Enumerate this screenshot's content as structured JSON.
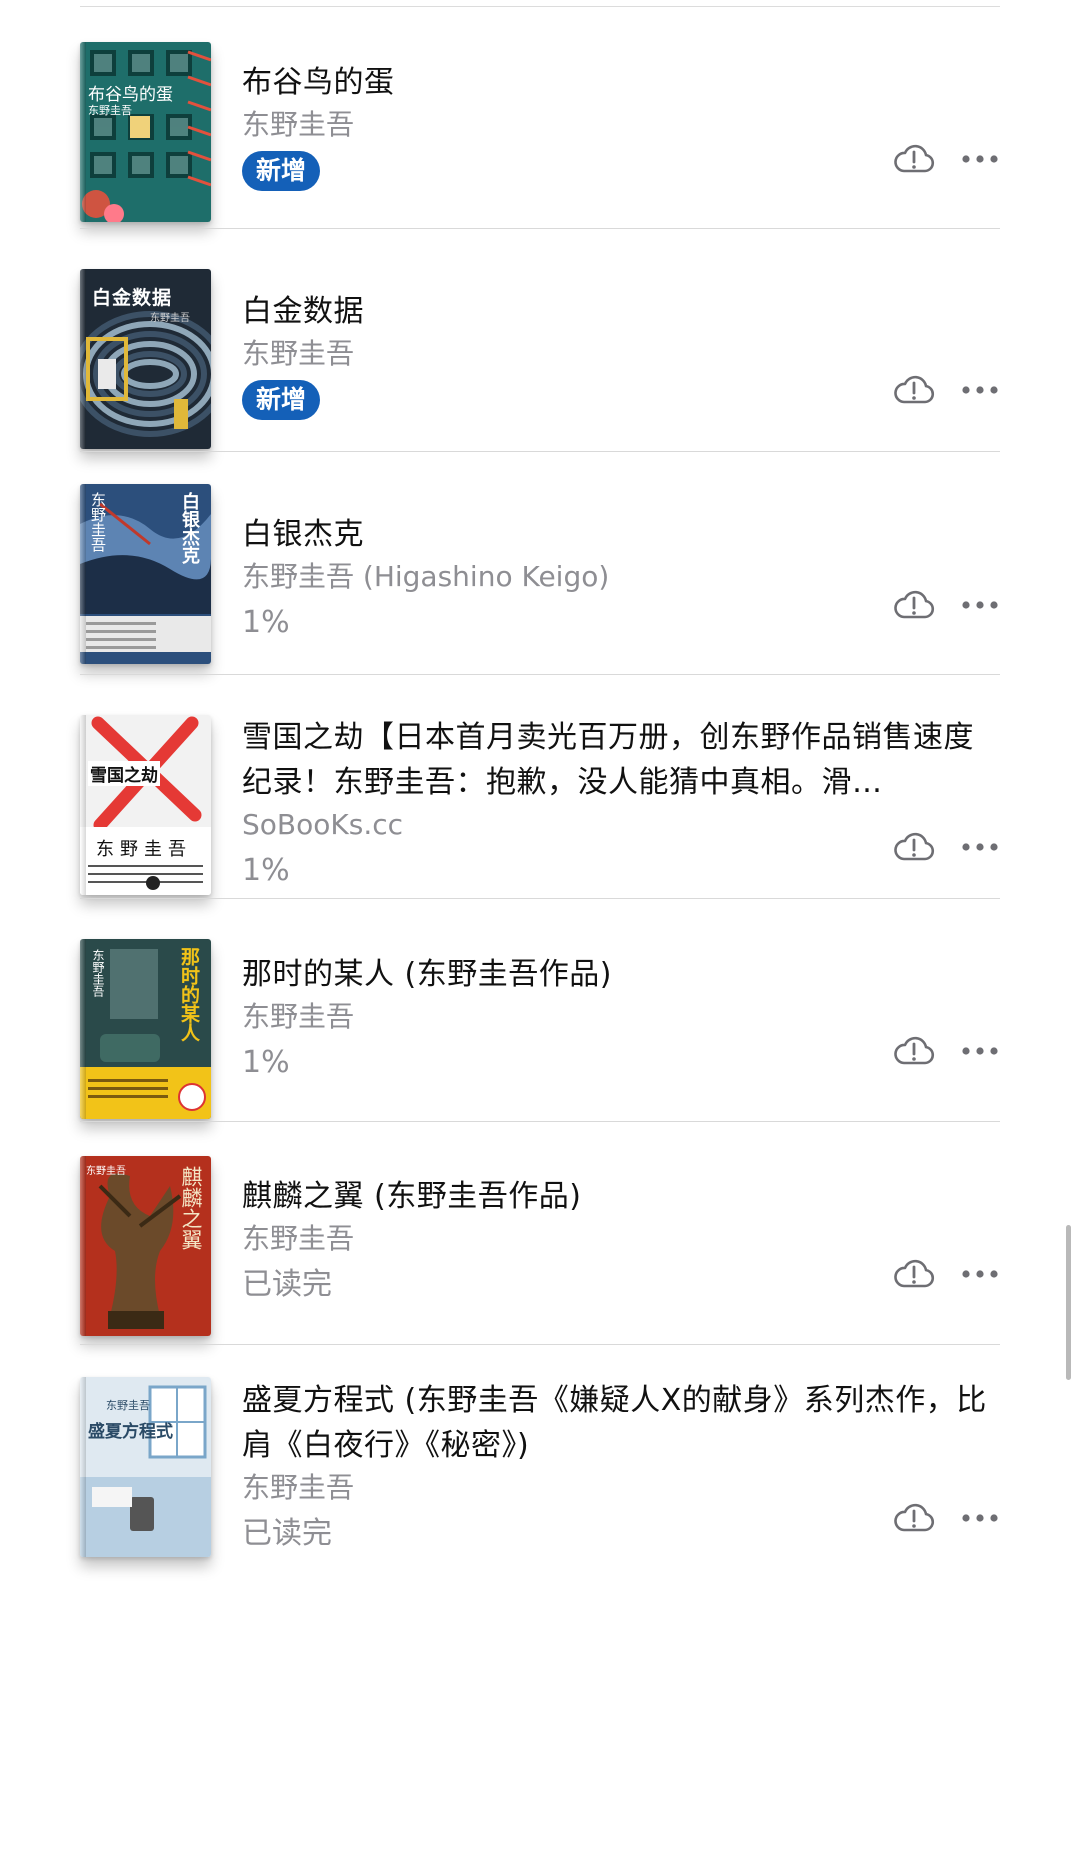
{
  "books": [
    {
      "title": "布谷鸟的蛋",
      "author": "东野圭吾",
      "status_type": "badge",
      "status": "新增",
      "cover": {
        "title": "布谷鸟的蛋",
        "author": "东野圭吾",
        "bg": "#1e6e6a",
        "accent": "#e2513d"
      }
    },
    {
      "title": "白金数据",
      "author": "东野圭吾",
      "status_type": "badge",
      "status": "新增",
      "cover": {
        "title": "白金数据",
        "author": "东野圭吾",
        "bg": "#1f2a36",
        "accent": "#e0b83a"
      }
    },
    {
      "title": "白银杰克",
      "author": "东野圭吾 (Higashino Keigo)",
      "status_type": "text",
      "status": "1%",
      "cover": {
        "title": "白银杰克",
        "author": "东野圭吾",
        "bg": "#2c4f7c",
        "accent": "#c0392b"
      }
    },
    {
      "title": "雪国之劫【日本首月卖光百万册，创东野作品销售速度纪录！东野圭吾：抱歉，没人能猜中真相。滑…",
      "author": "SoBooKs.cc",
      "status_type": "text",
      "status": "1%",
      "cover": {
        "title": "雪国之劫",
        "author": "东野圭吾",
        "bg": "#f2f2f2",
        "accent": "#e53935"
      }
    },
    {
      "title": "那时的某人 (东野圭吾作品)",
      "author": "东野圭吾",
      "status_type": "text",
      "status": "1%",
      "cover": {
        "title": "那时的某人",
        "author": "东野圭吾",
        "bg": "#2a4a4a",
        "accent": "#f2c318"
      }
    },
    {
      "title": "麒麟之翼 (东野圭吾作品)",
      "author": "东野圭吾",
      "status_type": "text",
      "status": "已读完",
      "cover": {
        "title": "麒麟之翼",
        "author": "东野圭吾",
        "bg": "#b4301d",
        "accent": "#6b4a2a"
      }
    },
    {
      "title": "盛夏方程式 (东野圭吾《嫌疑人X的献身》系列杰作，比肩《白夜行》《秘密》)",
      "author": "东野圭吾",
      "status_type": "text",
      "status": "已读完",
      "cover": {
        "title": "盛夏方程式",
        "author": "东野圭吾",
        "bg": "#dfe9f1",
        "accent": "#7aa6c9"
      }
    }
  ],
  "icons": {
    "cloud": "cloud-alert-icon",
    "more": "more-horizontal-icon"
  },
  "colors": {
    "badge": "#1460b8",
    "secondary_text": "#8e8e93",
    "divider": "#d9d9d9"
  }
}
